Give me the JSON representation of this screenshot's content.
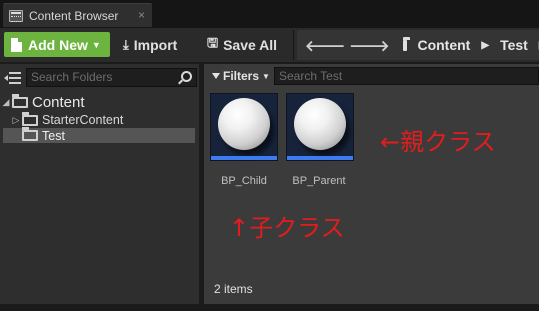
{
  "tab": {
    "title": "Content Browser",
    "close": "×"
  },
  "toolbar": {
    "add_new": "Add New",
    "import": "Import",
    "save_all": "Save All"
  },
  "breadcrumb": {
    "items": [
      "Content",
      "Test"
    ]
  },
  "left_panel": {
    "search_placeholder": "Search Folders",
    "tree": [
      {
        "label": "Content",
        "expanded": true
      },
      {
        "label": "StarterContent",
        "expanded": false
      },
      {
        "label": "Test",
        "selected": true
      }
    ]
  },
  "right_panel": {
    "filters_label": "Filters",
    "search_placeholder": "Search Test",
    "assets": [
      {
        "name": "BP_Child"
      },
      {
        "name": "BP_Parent"
      }
    ],
    "items_count": "2 items"
  },
  "annotations": {
    "parent_class": "←親クラス",
    "child_class": "↑子クラス"
  },
  "colors": {
    "add_button": "#6cb33f",
    "asset_bar": "#3d7bf0",
    "annotation": "#e31d1d"
  }
}
